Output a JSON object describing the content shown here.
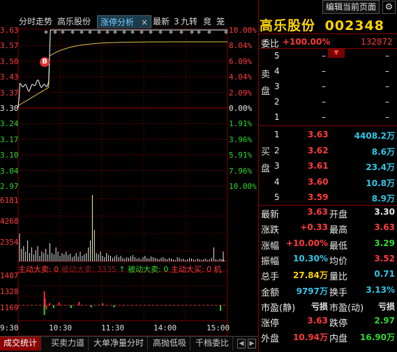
{
  "toolbar": {
    "edit_page": "编辑当前页面"
  },
  "chart_tabs": [
    {
      "label": "分时走势",
      "active": false
    },
    {
      "label": "高乐股份",
      "active": false
    },
    {
      "label": "涨停分析",
      "active": true
    },
    {
      "label": "最新",
      "active": false
    },
    {
      "label": "3",
      "active": false
    },
    {
      "label": "九转",
      "active": false
    },
    {
      "label": "竞",
      "active": false
    },
    {
      "label": "笼",
      "active": false
    }
  ],
  "close_glyph": "×",
  "price_axis_left": [
    "3.63",
    "3.57",
    "3.50",
    "3.43",
    "3.37",
    "3.30",
    "3.24",
    "3.17",
    "3.10",
    "3.04",
    "2.97"
  ],
  "pct_axis_right": [
    "10.00%",
    "8.04%",
    "6.09%",
    "4.04%",
    "2.09%",
    "0.00%",
    "1.91%",
    "3.96%",
    "5.91%",
    "7.96%",
    "10.00%"
  ],
  "volume_axis_left": [
    "6181",
    "4268",
    "2354"
  ],
  "flow_axis_left": [
    "1487",
    "1328",
    "1169"
  ],
  "time_axis": [
    "9:30",
    "10:30",
    "11:30",
    "14:00",
    "15:00"
  ],
  "marker_label": "B",
  "flow_legend": {
    "a": "主动大卖: 0",
    "b": "被动大卖: 3335",
    "c": "被动大卖: 0",
    "d": "主动大买: 0",
    "e": "机"
  },
  "chart_data": {
    "type": "line",
    "title": "",
    "x": [
      "9:30",
      "10:30",
      "11:30",
      "14:00",
      "15:00"
    ],
    "series": [
      {
        "values": [
          3.3,
          3.63,
          3.61,
          3.62,
          3.62
        ]
      }
    ],
    "ylim": [
      2.97,
      3.63
    ],
    "reference_price": 3.3
  },
  "bottom_tabs": [
    "成交统计",
    "买卖力道",
    "大单净量分时",
    "高抛低吸",
    "千档委比"
  ],
  "quote": {
    "stock_name": "高乐股份",
    "stock_code": "002348",
    "weibi_label": "委比",
    "weibi_value": "+100.00%",
    "weicha_value": "132872",
    "sell_label": "卖盘",
    "buy_label": "买盘",
    "sell_levels": [
      {
        "level": "5",
        "price": "–",
        "vol": "–"
      },
      {
        "level": "4",
        "price": "–",
        "vol": "–"
      },
      {
        "level": "3",
        "price": "–",
        "vol": "–"
      },
      {
        "level": "2",
        "price": "–",
        "vol": "–"
      },
      {
        "level": "1",
        "price": "–",
        "vol": "–"
      }
    ],
    "buy_levels": [
      {
        "level": "1",
        "price": "3.63",
        "vol": "4408.2万"
      },
      {
        "level": "2",
        "price": "3.62",
        "vol": "8.6万"
      },
      {
        "level": "3",
        "price": "3.61",
        "vol": "23.4万"
      },
      {
        "level": "4",
        "price": "3.60",
        "vol": "10.8万"
      },
      {
        "level": "5",
        "price": "3.59",
        "vol": "8.9万"
      }
    ],
    "stats": [
      {
        "l1": "最新",
        "v1": "3.63",
        "c1": "red",
        "l2": "开盘",
        "v2": "3.30",
        "c2": "white"
      },
      {
        "l1": "涨跌",
        "v1": "+0.33",
        "c1": "red",
        "l2": "最高",
        "v2": "3.63",
        "c2": "red"
      },
      {
        "l1": "涨幅",
        "v1": "+10.00%",
        "c1": "red",
        "l2": "最低",
        "v2": "3.29",
        "c2": "green"
      },
      {
        "l1": "振幅",
        "v1": "10.30%",
        "c1": "cyan",
        "l2": "均价",
        "v2": "3.52",
        "c2": "red"
      },
      {
        "l1": "总手",
        "v1": "27.84万",
        "c1": "yellow",
        "l2": "量比",
        "v2": "0.71",
        "c2": "cyan"
      },
      {
        "l1": "金额",
        "v1": "9797万",
        "c1": "cyan",
        "l2": "换手",
        "v2": "3.13%",
        "c2": "cyan"
      },
      {
        "l1": "市盈(静)",
        "v1": "亏损",
        "c1": "white",
        "l2": "市盈(动)",
        "v2": "亏损",
        "c2": "white"
      },
      {
        "l1": "涨停",
        "v1": "3.63",
        "c1": "red",
        "l2": "跌停",
        "v2": "2.97",
        "c2": "green"
      },
      {
        "l1": "外盘",
        "v1": "10.94万",
        "c1": "red",
        "l2": "内盘",
        "v2": "16.90万",
        "c2": "green"
      }
    ]
  },
  "colors": {
    "up": "#ff3b3b",
    "down": "#2ed82e",
    "grid": "#7a0000",
    "accent": "#ffd400"
  }
}
